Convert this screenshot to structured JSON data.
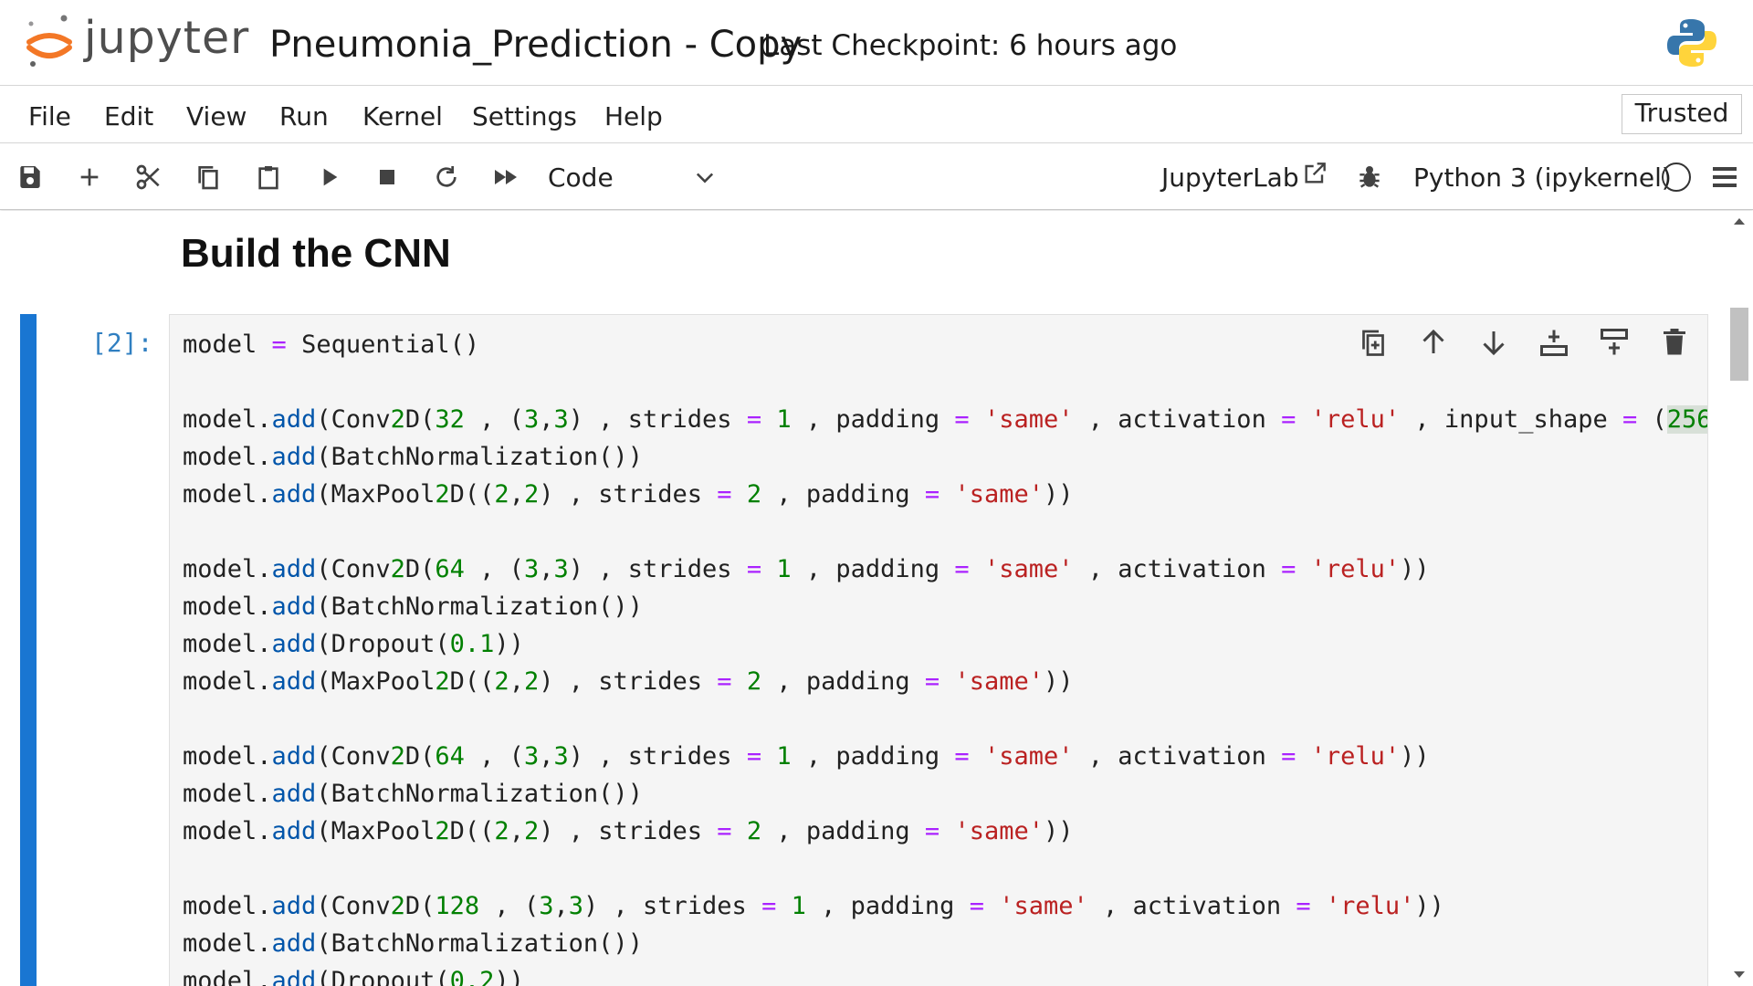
{
  "header": {
    "logo_text": "jupyter",
    "notebook_title": "Pneumonia_Prediction - Copy",
    "checkpoint": "Last Checkpoint: 6 hours ago"
  },
  "menu": {
    "items": [
      "File",
      "Edit",
      "View",
      "Run",
      "Kernel",
      "Settings",
      "Help"
    ],
    "trusted": "Trusted"
  },
  "toolbar": {
    "buttons": [
      "save-icon",
      "add-cell-icon",
      "cut-icon",
      "copy-icon",
      "paste-icon",
      "run-icon",
      "stop-icon",
      "restart-icon",
      "run-all-icon"
    ],
    "cell_type": "Code",
    "jupyterlab_link": "JupyterLab",
    "kernel": "Python 3 (ipykernel)"
  },
  "notebook": {
    "markdown_heading": "Build the CNN",
    "cell": {
      "prompt": "[2]:",
      "tools": [
        "duplicate-icon",
        "move-up-icon",
        "move-down-icon",
        "insert-below-icon",
        "insert-above-icon",
        "delete-icon"
      ],
      "code_lines": [
        "model = Sequential()",
        "",
        "model.add(Conv2D(32 , (3,3) , strides = 1 , padding = 'same' , activation = 'relu' , input_shape = (256,",
        "model.add(BatchNormalization())",
        "model.add(MaxPool2D((2,2) , strides = 2 , padding = 'same'))",
        "",
        "model.add(Conv2D(64 , (3,3) , strides = 1 , padding = 'same' , activation = 'relu'))",
        "model.add(BatchNormalization())",
        "model.add(Dropout(0.1))",
        "model.add(MaxPool2D((2,2) , strides = 2 , padding = 'same'))",
        "",
        "model.add(Conv2D(64 , (3,3) , strides = 1 , padding = 'same' , activation = 'relu'))",
        "model.add(BatchNormalization())",
        "model.add(MaxPool2D((2,2) , strides = 2 , padding = 'same'))",
        "",
        "model.add(Conv2D(128 , (3,3) , strides = 1 , padding = 'same' , activation = 'relu'))",
        "model.add(BatchNormalization())",
        "model.add(Dropout(0.2))"
      ]
    }
  },
  "colors": {
    "accent": "#1976d2",
    "prompt": "#307fc1",
    "keyword_op": "#aa22ff",
    "func": "#0055aa",
    "number": "#008000",
    "string": "#ba2121",
    "jupyter_orange": "#f37726"
  }
}
